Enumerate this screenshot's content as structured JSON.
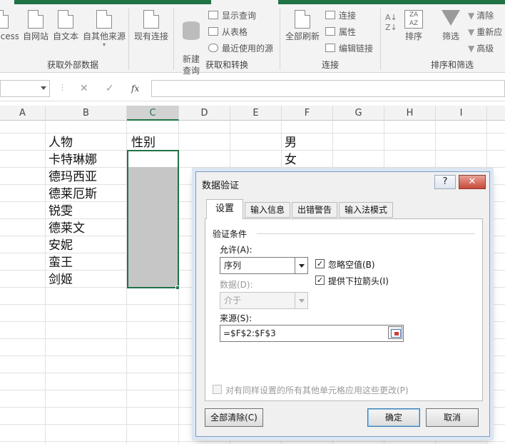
{
  "ribbon": {
    "groups": {
      "external": {
        "label": "获取外部数据",
        "access": "ccess",
        "web": "自网站",
        "text": "自文本",
        "other": "自其他来源"
      },
      "existing": "现有连接",
      "transform": {
        "label": "获取和转换",
        "new_query": "新建\n查询",
        "show_query": "显示查询",
        "from_table": "从表格",
        "recent_sources": "最近使用的源"
      },
      "connections": {
        "label": "连接",
        "refresh_all": "全部刷新",
        "connections": "连接",
        "properties": "属性",
        "edit_links": "编辑链接"
      },
      "sort_filter": {
        "label": "排序和筛选",
        "sort": "排序",
        "filter": "筛选",
        "clear": "清除",
        "reapply": "重新应",
        "advanced": "高级"
      }
    }
  },
  "formula_bar": {
    "cancel": "✕",
    "enter": "✓",
    "fx": "fx"
  },
  "sheet": {
    "columns": [
      "A",
      "B",
      "C",
      "D",
      "E",
      "F",
      "G",
      "H",
      "I"
    ],
    "cells": {
      "B1": "人物",
      "C1": "性别",
      "B2": "卡特琳娜",
      "B3": "德玛西亚",
      "B4": "德莱厄斯",
      "B5": "锐雯",
      "B6": "德莱文",
      "B7": "安妮",
      "B8": "蛮王",
      "B9": "剑姬",
      "F1": "男",
      "F2": "女"
    }
  },
  "dialog": {
    "title": "数据验证",
    "help": "?",
    "close": "✕",
    "tabs": [
      "设置",
      "输入信息",
      "出错警告",
      "输入法模式"
    ],
    "section_title": "验证条件",
    "allow_label": "允许(A):",
    "allow_value": "序列",
    "data_label": "数据(D):",
    "data_value": "介于",
    "ignore_blank": "忽略空值(B)",
    "dropdown_arrow": "提供下拉箭头(I)",
    "source_label": "来源(S):",
    "source_value": "=$F$2:$F$3",
    "apply_all": "对有同样设置的所有其他单元格应用这些更改(P)",
    "clear_all": "全部清除(C)",
    "ok": "确定",
    "cancel": "取消"
  }
}
